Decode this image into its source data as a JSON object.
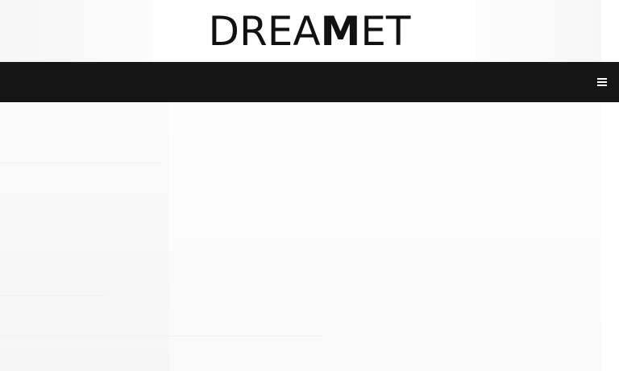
{
  "brand": {
    "logo_prefix": "DREA",
    "logo_emphasis": "M",
    "logo_suffix": "ET"
  },
  "navbar": {
    "menu_icon": "hamburger-menu-icon",
    "background_color": "#161616"
  }
}
